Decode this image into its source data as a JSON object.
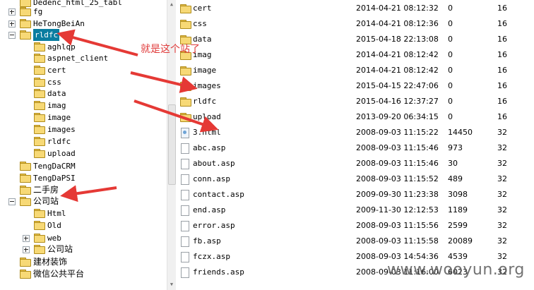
{
  "tree": {
    "items": [
      {
        "label": "Dedenc_html_25_tabl",
        "expander": "none",
        "cjk": false
      },
      {
        "label": "fg",
        "expander": "plus",
        "cjk": false
      },
      {
        "label": "HeTongBeiAn",
        "expander": "plus",
        "cjk": false
      },
      {
        "label": "rldfc",
        "expander": "minus",
        "cjk": false,
        "selected": true
      },
      {
        "label": "aghlqp",
        "expander": "none",
        "cjk": false
      },
      {
        "label": "aspnet_client",
        "expander": "none",
        "cjk": false
      },
      {
        "label": "cert",
        "expander": "none",
        "cjk": false
      },
      {
        "label": "css",
        "expander": "none",
        "cjk": false
      },
      {
        "label": "data",
        "expander": "none",
        "cjk": false
      },
      {
        "label": "imag",
        "expander": "none",
        "cjk": false
      },
      {
        "label": "image",
        "expander": "none",
        "cjk": false
      },
      {
        "label": "images",
        "expander": "none",
        "cjk": false
      },
      {
        "label": "rldfc",
        "expander": "none",
        "cjk": false
      },
      {
        "label": "upload",
        "expander": "none",
        "cjk": false
      },
      {
        "label": "TengDaCRM",
        "expander": "none",
        "cjk": false
      },
      {
        "label": "TengDaPSI",
        "expander": "none",
        "cjk": false
      },
      {
        "label": "二手房",
        "expander": "none",
        "cjk": true
      },
      {
        "label": "公司站",
        "expander": "minus",
        "cjk": true
      },
      {
        "label": "Html",
        "expander": "none",
        "cjk": false
      },
      {
        "label": "Old",
        "expander": "none",
        "cjk": false
      },
      {
        "label": "web",
        "expander": "plus",
        "cjk": false
      },
      {
        "label": "公司站",
        "expander": "plus",
        "cjk": true
      },
      {
        "label": "建材装饰",
        "expander": "none",
        "cjk": true
      },
      {
        "label": "微信公共平台",
        "expander": "none",
        "cjk": true
      }
    ]
  },
  "files": [
    {
      "name": "cert",
      "type": "folder",
      "date": "2014-04-21 08:12:32",
      "size": "0",
      "perm": "16"
    },
    {
      "name": "css",
      "type": "folder",
      "date": "2014-04-21 08:12:36",
      "size": "0",
      "perm": "16"
    },
    {
      "name": "data",
      "type": "folder",
      "date": "2015-04-18 22:13:08",
      "size": "0",
      "perm": "16"
    },
    {
      "name": "imag",
      "type": "folder",
      "date": "2014-04-21 08:12:42",
      "size": "0",
      "perm": "16"
    },
    {
      "name": "image",
      "type": "folder",
      "date": "2014-04-21 08:12:42",
      "size": "0",
      "perm": "16"
    },
    {
      "name": "images",
      "type": "folder",
      "date": "2015-04-15 22:47:06",
      "size": "0",
      "perm": "16"
    },
    {
      "name": "rldfc",
      "type": "folder",
      "date": "2015-04-16 12:37:27",
      "size": "0",
      "perm": "16"
    },
    {
      "name": "upload",
      "type": "folder",
      "date": "2013-09-20 06:34:15",
      "size": "0",
      "perm": "16"
    },
    {
      "name": "3.html",
      "type": "html",
      "date": "2008-09-03 11:15:22",
      "size": "14450",
      "perm": "32"
    },
    {
      "name": "abc.asp",
      "type": "file",
      "date": "2008-09-03 11:15:46",
      "size": "973",
      "perm": "32"
    },
    {
      "name": "about.asp",
      "type": "file",
      "date": "2008-09-03 11:15:46",
      "size": "30",
      "perm": "32"
    },
    {
      "name": "conn.asp",
      "type": "file",
      "date": "2008-09-03 11:15:52",
      "size": "489",
      "perm": "32"
    },
    {
      "name": "contact.asp",
      "type": "file",
      "date": "2009-09-30 11:23:38",
      "size": "3098",
      "perm": "32"
    },
    {
      "name": "end.asp",
      "type": "file",
      "date": "2009-11-30 12:12:53",
      "size": "1189",
      "perm": "32"
    },
    {
      "name": "error.asp",
      "type": "file",
      "date": "2008-09-03 11:15:56",
      "size": "2599",
      "perm": "32"
    },
    {
      "name": "fb.asp",
      "type": "file",
      "date": "2008-09-03 11:15:58",
      "size": "20089",
      "perm": "32"
    },
    {
      "name": "fczx.asp",
      "type": "file",
      "date": "2008-09-03 14:54:36",
      "size": "4539",
      "perm": "32"
    },
    {
      "name": "friends.asp",
      "type": "file",
      "date": "2008-09-03 11:16:00",
      "size": "6023",
      "perm": "32"
    }
  ],
  "annotation": {
    "text": "就是这个站了",
    "color": "#e03b3b"
  },
  "watermark": {
    "text": "www.wooyun.org"
  },
  "colors": {
    "selection": "#0a7da0",
    "folder": "#f7d976",
    "arrow": "#e53935"
  }
}
